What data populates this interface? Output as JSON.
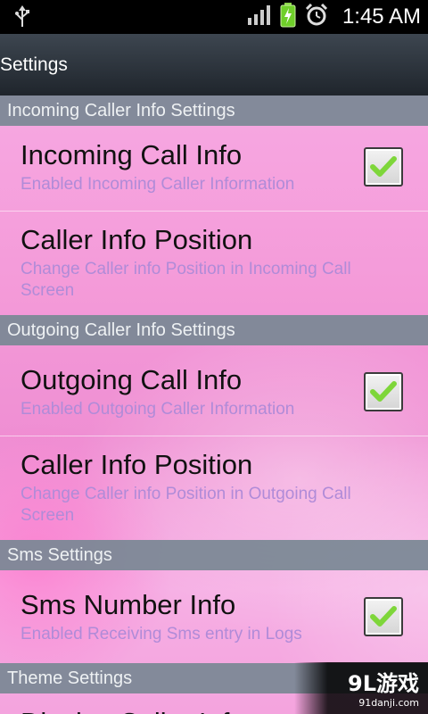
{
  "status_bar": {
    "time": "1:45 AM",
    "icons": [
      "usb-icon",
      "signal-icon",
      "battery-charging-icon",
      "alarm-icon"
    ]
  },
  "title_bar": {
    "title": "Settings"
  },
  "sections": [
    {
      "header": "Incoming Caller Info Settings",
      "items": [
        {
          "title": "Incoming Call Info",
          "summary": "Enabled Incoming Caller Information",
          "checked": true
        },
        {
          "title": "Caller Info Position",
          "summary": "Change Caller info Position in Incoming Call Screen"
        }
      ]
    },
    {
      "header": "Outgoing Caller Info Settings",
      "items": [
        {
          "title": "Outgoing Call Info",
          "summary": "Enabled Outgoing Caller Information",
          "checked": true
        },
        {
          "title": "Caller Info Position",
          "summary": "Change Caller info Position in Outgoing Call Screen"
        }
      ]
    },
    {
      "header": "Sms Settings",
      "items": [
        {
          "title": "Sms Number Info",
          "summary": "Enabled Receiving Sms entry in Logs",
          "checked": true
        }
      ]
    },
    {
      "header": "Theme Settings",
      "items": [
        {
          "title": "Display Caller Info"
        }
      ]
    }
  ],
  "watermark": {
    "brand": "9L游戏",
    "site": "91danji.com"
  },
  "colors": {
    "header_bg": "#78889A",
    "summary_text": "#B08BD8",
    "title_text": "#111111",
    "check_green": "#7ED63A"
  }
}
